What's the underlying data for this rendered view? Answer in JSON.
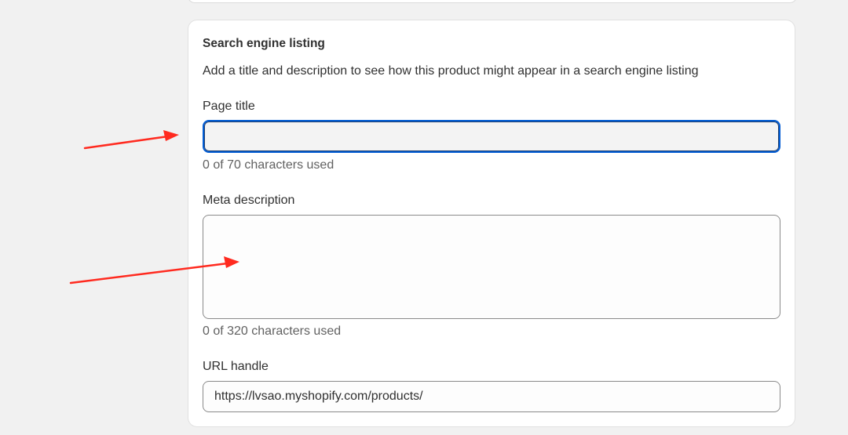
{
  "seo": {
    "title": "Search engine listing",
    "description": "Add a title and description to see how this product might appear in a search engine listing",
    "page_title": {
      "label": "Page title",
      "value": "",
      "help": "0 of 70 characters used"
    },
    "meta_description": {
      "label": "Meta description",
      "value": "",
      "help": "0 of 320 characters used"
    },
    "url_handle": {
      "label": "URL handle",
      "value": "https://lvsao.myshopify.com/products/"
    }
  },
  "colors": {
    "background": "#f1f1f1",
    "card": "#ffffff",
    "focus_border": "#005bd3",
    "annotation_arrow": "#ff2a1f"
  }
}
